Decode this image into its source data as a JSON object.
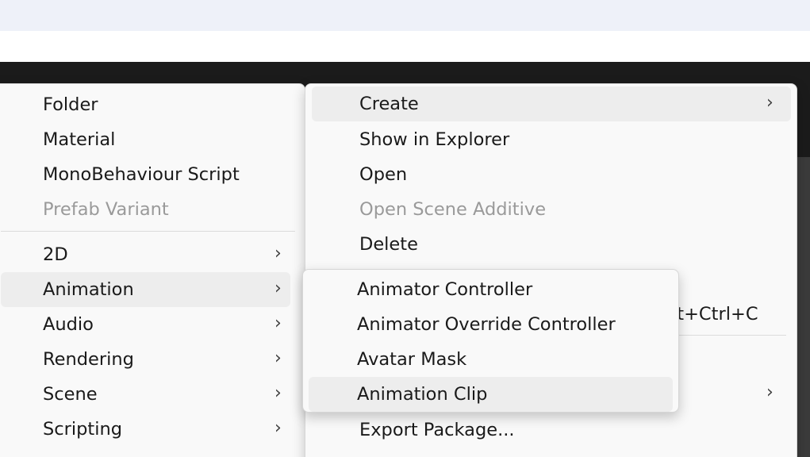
{
  "create_menu": {
    "items": [
      {
        "label": "Folder",
        "disabled": false
      },
      {
        "label": "Material",
        "disabled": false
      },
      {
        "label": "MonoBehaviour Script",
        "disabled": false
      },
      {
        "label": "Prefab Variant",
        "disabled": true
      }
    ],
    "submenus": [
      {
        "label": "2D",
        "arrow": "›"
      },
      {
        "label": "Animation",
        "arrow": "›"
      },
      {
        "label": "Audio",
        "arrow": "›"
      },
      {
        "label": "Rendering",
        "arrow": "›"
      },
      {
        "label": "Scene",
        "arrow": "›"
      },
      {
        "label": "Scripting",
        "arrow": "›"
      }
    ]
  },
  "context_menu": {
    "items": [
      {
        "label": "Create",
        "arrow": "›"
      },
      {
        "label": "Show in Explorer"
      },
      {
        "label": "Open"
      },
      {
        "label": "Open Scene Additive",
        "disabled": true
      },
      {
        "label": "Delete"
      }
    ],
    "shortcut_partial": "lt+Ctrl+C",
    "hidden_submenu_arrow": "›",
    "bottom_item": {
      "label": "Export Package..."
    }
  },
  "animation_submenu": {
    "items": [
      {
        "label": "Animator Controller"
      },
      {
        "label": "Animator Override Controller"
      },
      {
        "label": "Avatar Mask"
      },
      {
        "label": "Animation Clip"
      }
    ]
  }
}
